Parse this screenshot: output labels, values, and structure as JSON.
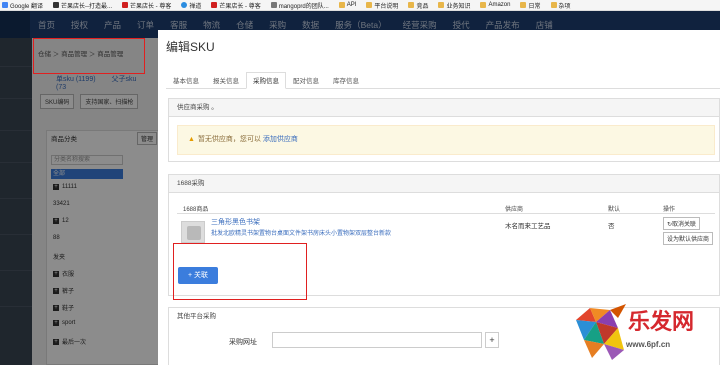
{
  "bookmarks": [
    {
      "label": "Google 翻译",
      "icon": "google-icon"
    },
    {
      "label": "芒果店长--打造最...",
      "icon": "bookmark-icon"
    },
    {
      "label": "芒果店长 - 尊客",
      "icon": "cc-icon"
    },
    {
      "label": "禅道",
      "icon": "zentao-icon"
    },
    {
      "label": "芒果店长 - 尊客",
      "icon": "cc-icon"
    },
    {
      "label": "mangoprd的团队...",
      "icon": "cc-icon"
    },
    {
      "label": "API",
      "icon": "folder-icon"
    },
    {
      "label": "平台说明",
      "icon": "folder-icon"
    },
    {
      "label": "竞品",
      "icon": "folder-icon"
    },
    {
      "label": "业务知识",
      "icon": "folder-icon"
    },
    {
      "label": "Amazon",
      "icon": "folder-icon"
    },
    {
      "label": "日常",
      "icon": "folder-icon"
    },
    {
      "label": "杂项",
      "icon": "folder-icon"
    }
  ],
  "topnav": [
    "首页",
    "授权",
    "产品",
    "订单",
    "客服",
    "物流",
    "仓储",
    "采购",
    "数据",
    "服务（Beta）",
    "经营采购",
    "授代",
    "产品发布",
    "店铺"
  ],
  "background_page": {
    "breadcrumb": "仓储 ＞ 商品管理 ＞ 商品管理",
    "tabs": [
      "单sku (1199)",
      "父子sku (73"
    ],
    "buttons": [
      "SKU编码",
      "支持国家、扫描枪"
    ],
    "category_header": "商品分类",
    "manage_button": "管理",
    "search_placeholder": "分类名称搜索",
    "all_label": "全部",
    "categories": [
      "11111",
      "33421",
      "12",
      "88",
      "发夹",
      "衣服",
      "裤子",
      "鞋子",
      "sport",
      "最后一次"
    ]
  },
  "modal": {
    "title": "编辑SKU",
    "tabs": [
      "基本信息",
      "报关信息",
      "采购信息",
      "配对信息",
      "库存信息"
    ],
    "active_tab": "采购信息",
    "supplier_panel": {
      "header": "供应商采购 。",
      "warning_text": "暂无供应商，您可以",
      "warning_link": "添加供应商"
    },
    "alibaba_panel": {
      "header": "1688采购",
      "columns": [
        "1688商品",
        "供应商",
        "默认",
        "操作"
      ],
      "row": {
        "name": "三角形黑色书架",
        "desc": "批发北欧精灵书架置物台桌面文件架书房床头小置物架双层整台新款",
        "supplier": "木名而来工艺品",
        "default": "否",
        "op_unlink": "取消关联",
        "op_set_default": "设为默认供应商"
      },
      "associate_button": "关联"
    },
    "other_panel": {
      "header": "其他平台采购",
      "url_label": "采购网址",
      "url_value": "",
      "add_label": "+"
    }
  },
  "watermark": {
    "brand": "乐发网",
    "url": "www.6pf.cn"
  },
  "colors": {
    "primary": "#3b7ddd",
    "nav": "#1e3f72",
    "highlight_box": "#e02020",
    "warning_bg": "#fcf8e3"
  }
}
